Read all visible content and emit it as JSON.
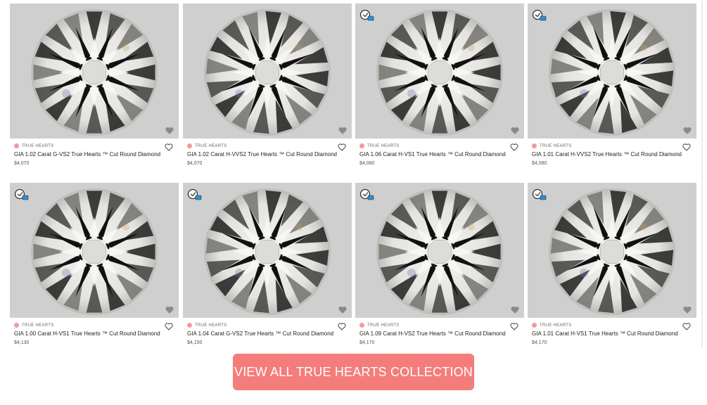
{
  "products": [
    {
      "tag": "TRUE HEARTS",
      "title": "GIA 1.02 Carat G-VS2 True Hearts ™ Cut Round Diamond",
      "price": "$4,070",
      "video": false
    },
    {
      "tag": "TRUE HEARTS",
      "title": "GIA 1.02 Carat H-VVS2 True Hearts ™ Cut Round Diamond",
      "price": "$4,070",
      "video": false
    },
    {
      "tag": "TRUE HEARTS",
      "title": "GIA 1.06 Carat H-VS1 True Hearts ™ Cut Round Diamond",
      "price": "$4,080",
      "video": true
    },
    {
      "tag": "TRUE HEARTS",
      "title": "GIA 1.01 Carat H-VVS2 True Hearts ™ Cut Round Diamond",
      "price": "$4,080",
      "video": true
    },
    {
      "tag": "TRUE HEARTS",
      "title": "GIA 1.00 Carat H-VS1 True Hearts ™ Cut Round Diamond",
      "price": "$4,130",
      "video": true
    },
    {
      "tag": "TRUE HEARTS",
      "title": "GIA 1.04 Carat G-VS2 True Hearts ™ Cut Round Diamond",
      "price": "$4,150",
      "video": true
    },
    {
      "tag": "TRUE HEARTS",
      "title": "GIA 1.09 Carat H-VS2 True Hearts ™ Cut Round Diamond",
      "price": "$4,170",
      "video": true
    },
    {
      "tag": "TRUE HEARTS",
      "title": "GIA 1.01 Carat H-VS1 True Hearts ™ Cut Round Diamond",
      "price": "$4,170",
      "video": true
    }
  ],
  "cta": {
    "label": "VIEW ALL TRUE HEARTS COLLECTION"
  },
  "colors": {
    "accent": "#f47d7b",
    "tag_dot": "#f29a9a",
    "photo_bg": "#cfcfcf"
  },
  "icons": {
    "video": "360-video-icon",
    "wishlist": "heart-icon"
  }
}
